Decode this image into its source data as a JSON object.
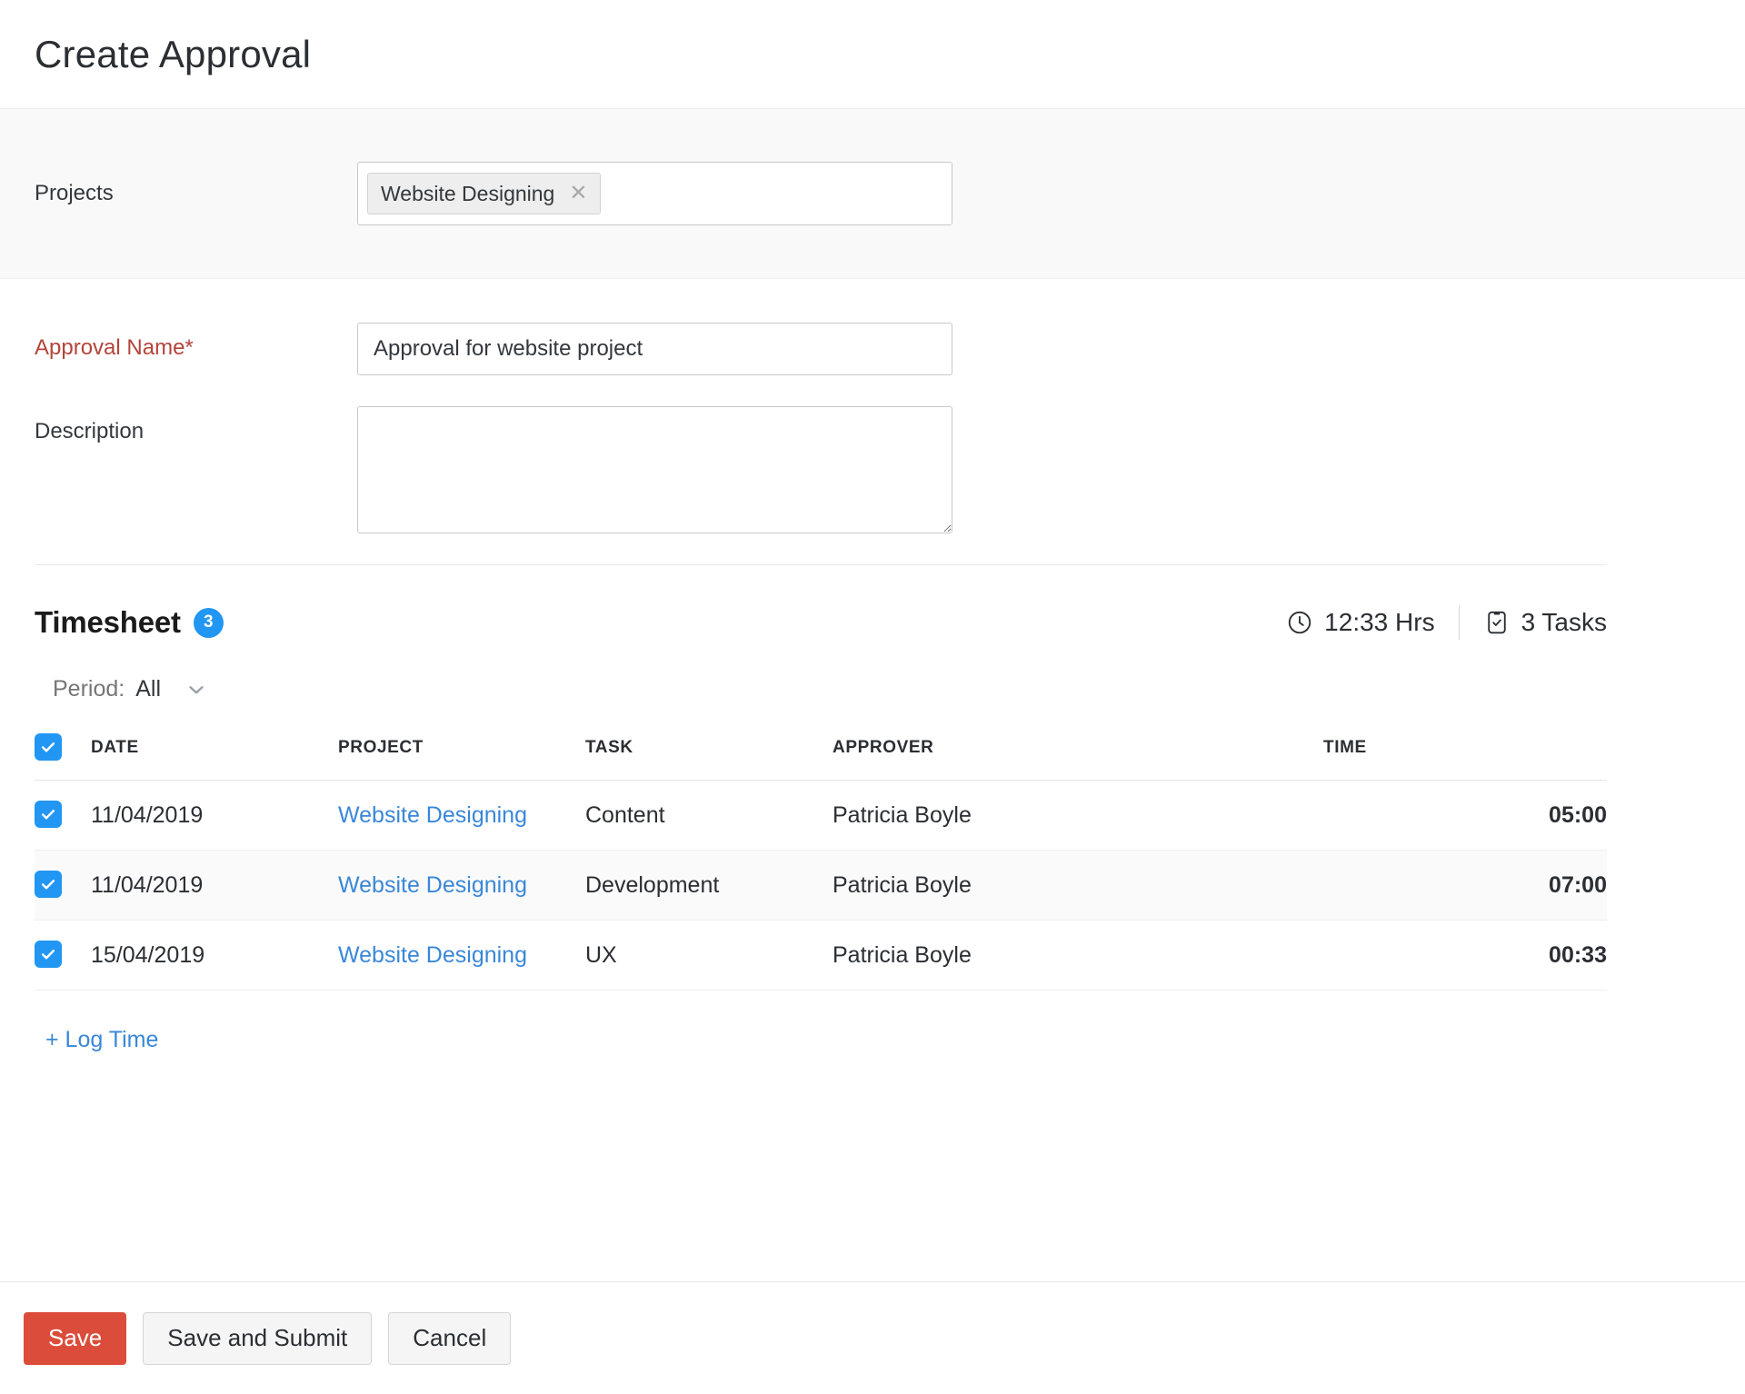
{
  "header": {
    "title": "Create Approval"
  },
  "projects": {
    "label": "Projects",
    "chips": [
      {
        "label": "Website Designing",
        "remove_icon": "close-icon"
      }
    ]
  },
  "form": {
    "approval_name": {
      "label": "Approval Name*",
      "value": "Approval for website project",
      "placeholder": ""
    },
    "description": {
      "label": "Description",
      "value": "",
      "placeholder": ""
    }
  },
  "timesheet": {
    "title": "Timesheet",
    "count_badge": "3",
    "stats": {
      "hours_icon": "clock-icon",
      "hours": "12:33 Hrs",
      "tasks_icon": "task-checklist-icon",
      "tasks": "3 Tasks"
    },
    "period": {
      "label": "Period:",
      "value": "All",
      "caret_icon": "chevron-down-icon"
    },
    "table": {
      "select_all_checked": true,
      "columns": [
        "DATE",
        "PROJECT",
        "TASK",
        "APPROVER",
        "TIME"
      ],
      "rows": [
        {
          "checked": true,
          "date": "11/04/2019",
          "project": "Website Designing",
          "task": "Content",
          "approver": "Patricia Boyle",
          "time": "05:00"
        },
        {
          "checked": true,
          "date": "11/04/2019",
          "project": "Website Designing",
          "task": "Development",
          "approver": "Patricia Boyle",
          "time": "07:00"
        },
        {
          "checked": true,
          "date": "15/04/2019",
          "project": "Website Designing",
          "task": "UX",
          "approver": "Patricia Boyle",
          "time": "00:33"
        }
      ]
    },
    "log_time_label": "+ Log Time"
  },
  "footer": {
    "save_label": "Save",
    "save_submit_label": "Save and Submit",
    "cancel_label": "Cancel"
  },
  "colors": {
    "primary_button": "#db4c3a",
    "link": "#3a87d8",
    "checkbox": "#2196f3",
    "badge": "#2196f3",
    "required_label": "#b4443a"
  }
}
